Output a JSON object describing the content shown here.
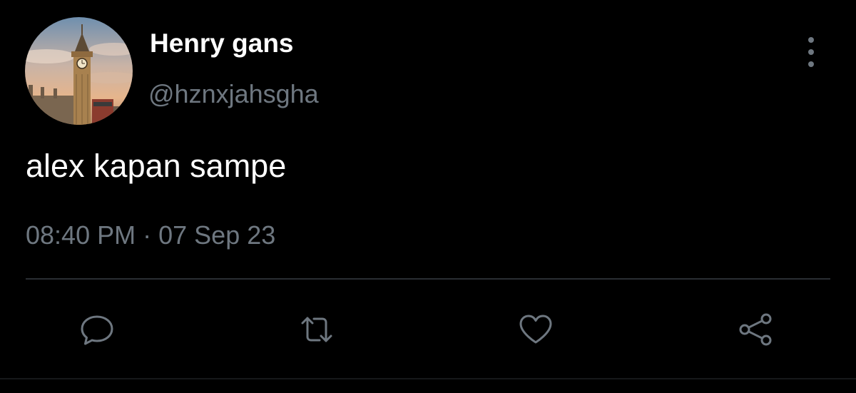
{
  "tweet": {
    "author": {
      "display_name": "Henry gans",
      "handle": "@hznxjahsgha",
      "avatar_icon": "big-ben-photo"
    },
    "text": "alex kapan sampe",
    "time": "08:40 PM",
    "separator": "·",
    "date": "07 Sep 23"
  },
  "actions": {
    "reply_icon": "speech-bubble-icon",
    "retweet_icon": "retweet-arrows-icon",
    "like_icon": "heart-icon",
    "share_icon": "share-nodes-icon"
  },
  "colors": {
    "background": "#000000",
    "primary_text": "#ffffff",
    "secondary_text": "#6e7780",
    "divider": "#2a2e33"
  }
}
